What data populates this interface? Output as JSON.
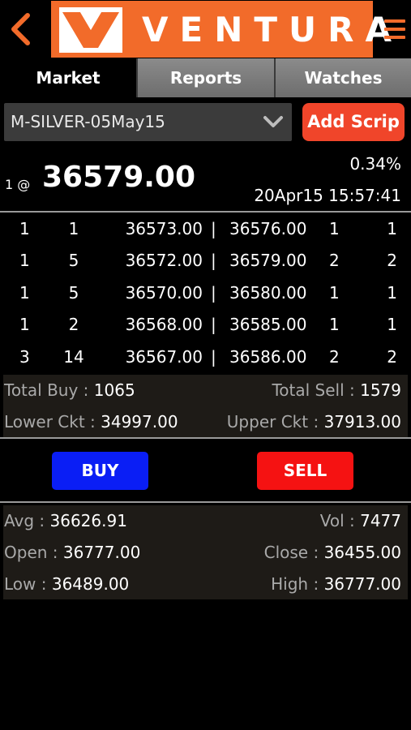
{
  "header": {
    "logo_text": "VENTURA",
    "back_icon": "chevron-left-icon",
    "menu_icon": "hamburger-menu-icon",
    "brand_color": "#f26b2a"
  },
  "tabs": [
    {
      "label": "Market",
      "active": true
    },
    {
      "label": "Reports",
      "active": false
    },
    {
      "label": "Watches",
      "active": false
    }
  ],
  "scrip": {
    "selected": "M-SILVER-05May15",
    "add_label": "Add Scrip"
  },
  "quote": {
    "qty_at": "1 @",
    "ltp": "36579.00",
    "change_pct": "0.34%",
    "timestamp": "20Apr15 15:57:41"
  },
  "depth": [
    {
      "b_orders": "1",
      "b_qty": "1",
      "bid": "36573.00",
      "sep": "|",
      "ask": "36576.00",
      "s_qty": "1",
      "s_orders": "1"
    },
    {
      "b_orders": "1",
      "b_qty": "5",
      "bid": "36572.00",
      "sep": "|",
      "ask": "36579.00",
      "s_qty": "2",
      "s_orders": "2"
    },
    {
      "b_orders": "1",
      "b_qty": "5",
      "bid": "36570.00",
      "sep": "|",
      "ask": "36580.00",
      "s_qty": "1",
      "s_orders": "1"
    },
    {
      "b_orders": "1",
      "b_qty": "2",
      "bid": "36568.00",
      "sep": "|",
      "ask": "36585.00",
      "s_qty": "1",
      "s_orders": "1"
    },
    {
      "b_orders": "3",
      "b_qty": "14",
      "bid": "36567.00",
      "sep": "|",
      "ask": "36586.00",
      "s_qty": "2",
      "s_orders": "2"
    }
  ],
  "totals": {
    "total_buy_label": "Total Buy :",
    "total_buy": "1065",
    "total_sell_label": "Total Sell :",
    "total_sell": "1579",
    "lower_ckt_label": "Lower Ckt :",
    "lower_ckt": "34997.00",
    "upper_ckt_label": "Upper Ckt :",
    "upper_ckt": "37913.00"
  },
  "actions": {
    "buy_label": "BUY",
    "sell_label": "SELL",
    "buy_color": "#0a1ef5",
    "sell_color": "#f51212"
  },
  "stats": {
    "avg_label": "Avg :",
    "avg": "36626.91",
    "vol_label": "Vol :",
    "vol": "7477",
    "open_label": "Open :",
    "open": "36777.00",
    "close_label": "Close :",
    "close": "36455.00",
    "low_label": "Low :",
    "low": "36489.00",
    "high_label": "High :",
    "high": "36777.00"
  }
}
